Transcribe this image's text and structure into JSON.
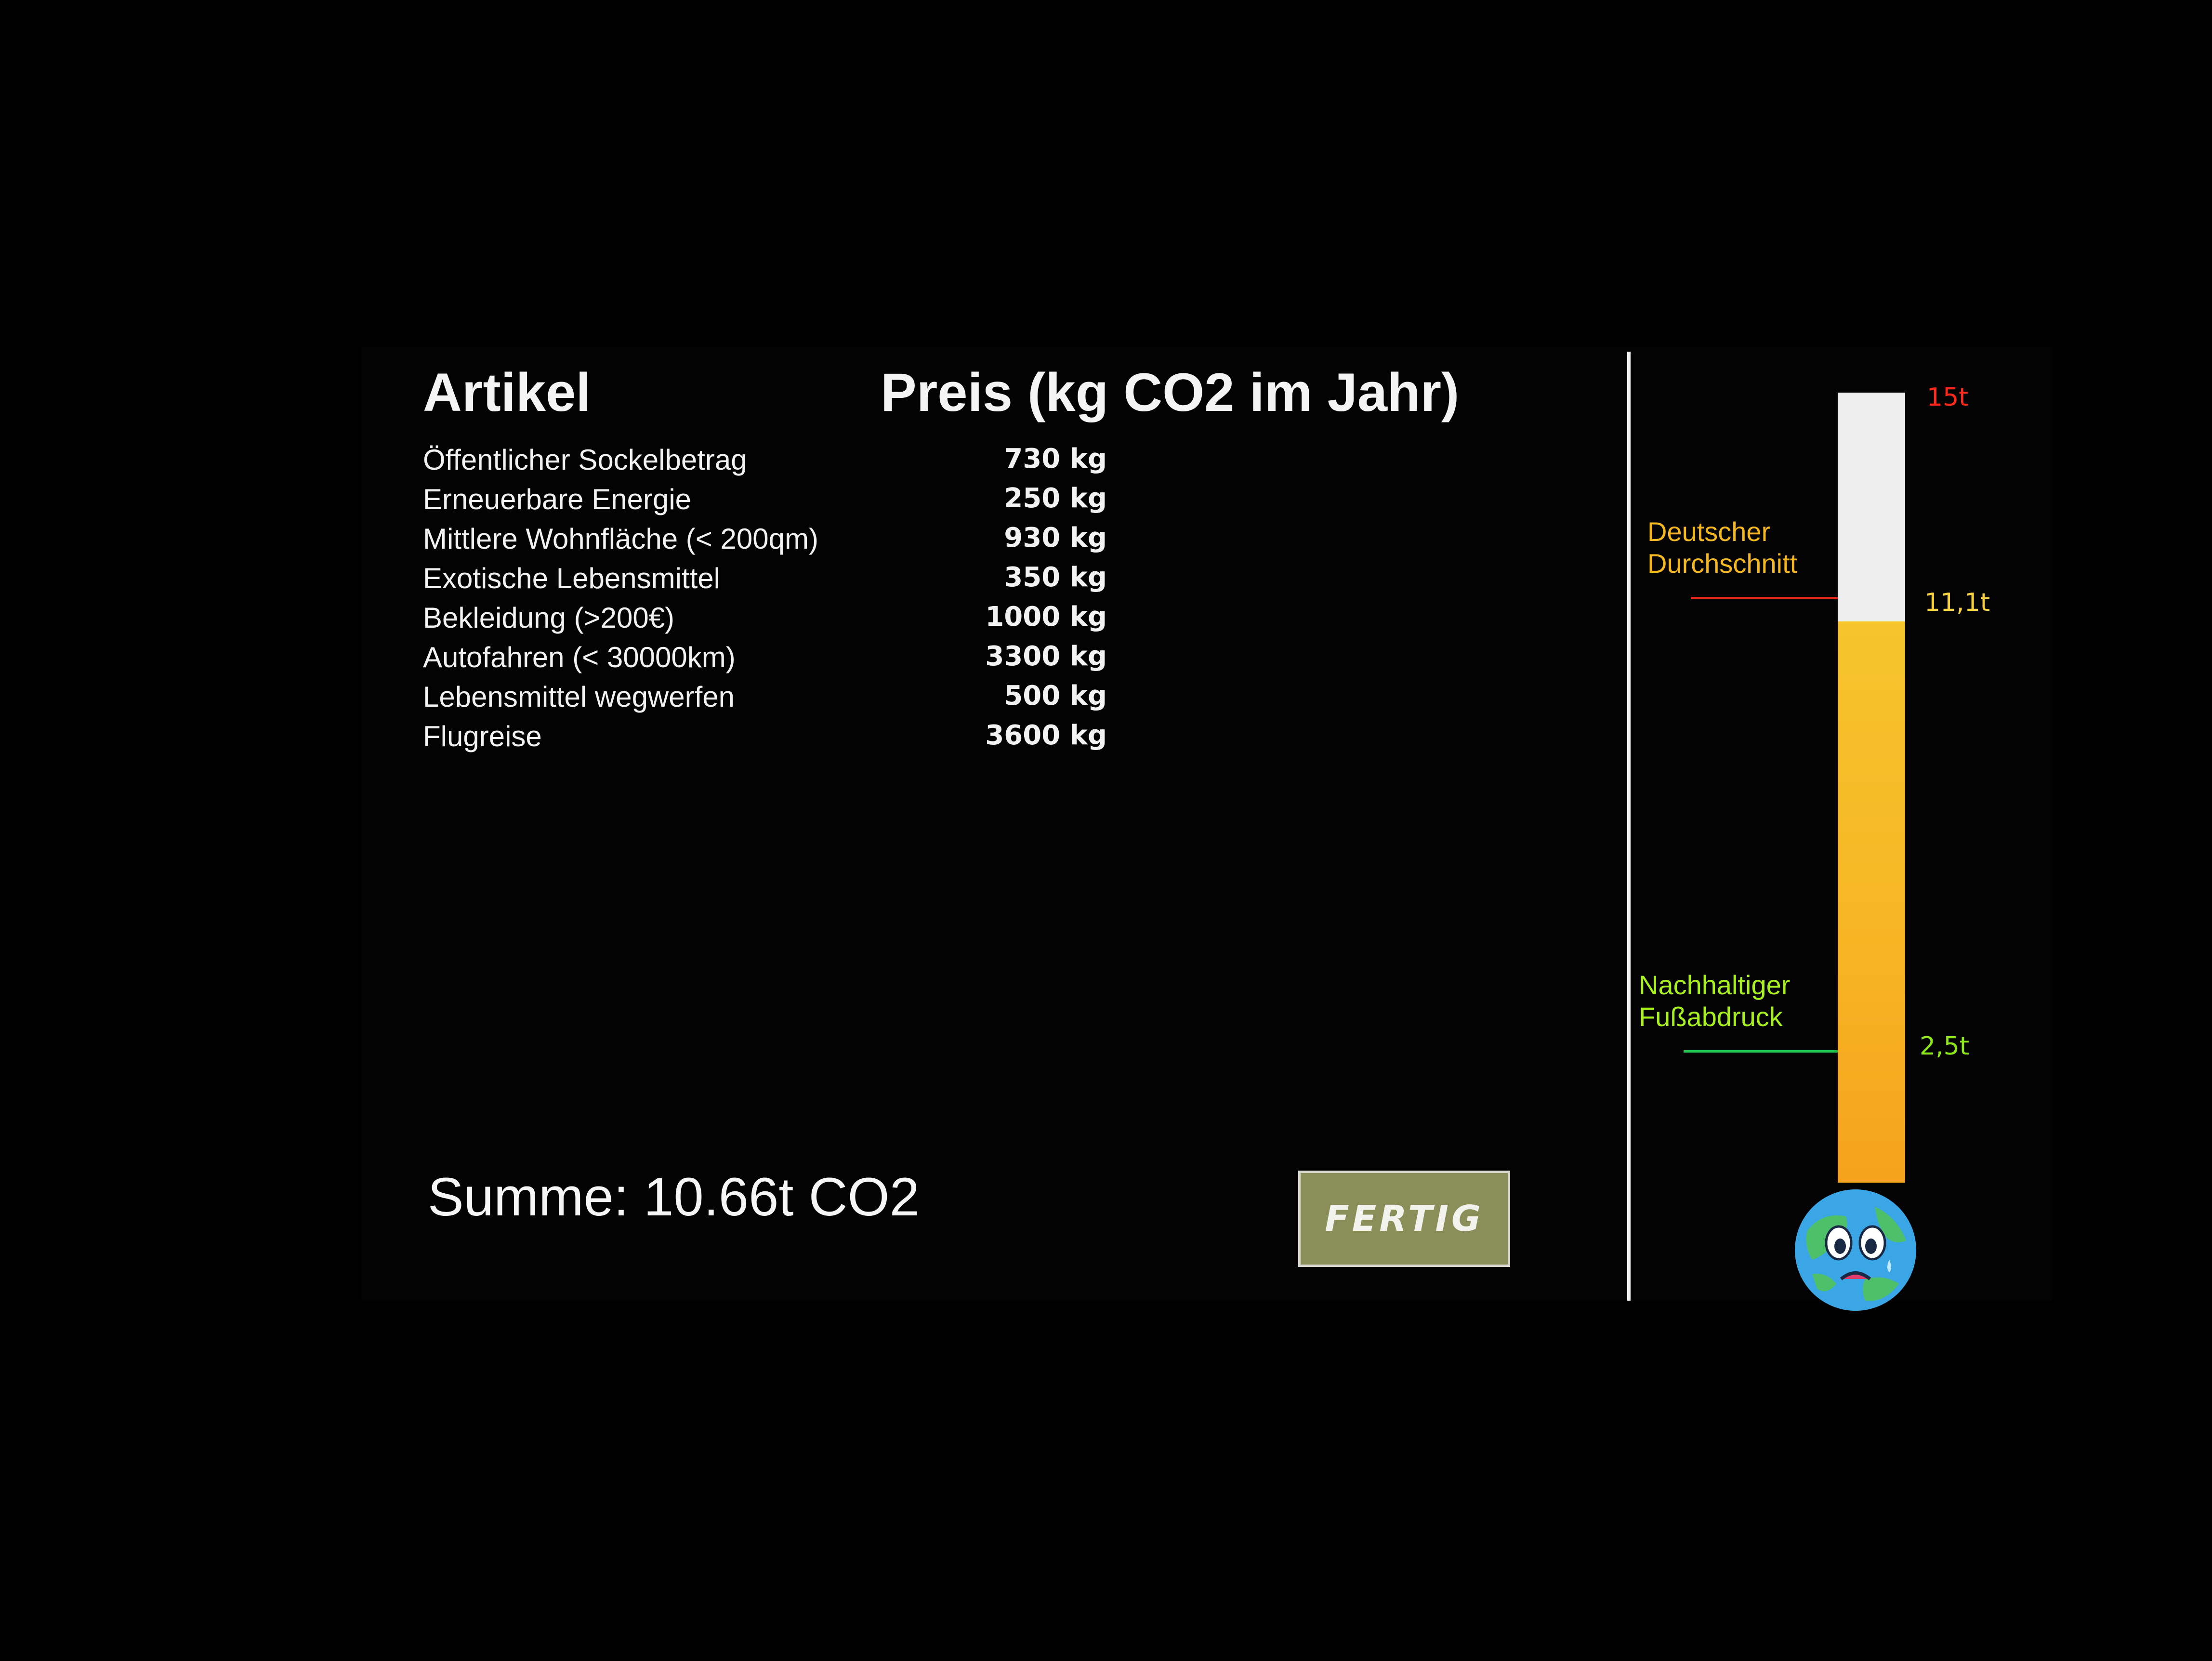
{
  "table": {
    "col_item": "Artikel",
    "col_price": "Preis (kg CO2 im Jahr)",
    "rows": [
      {
        "name": "Öffentlicher Sockelbetrag",
        "value": "730 kg"
      },
      {
        "name": "Erneuerbare Energie",
        "value": "250 kg"
      },
      {
        "name": "Mittlere Wohnfläche (< 200qm)",
        "value": "930 kg"
      },
      {
        "name": "Exotische Lebensmittel",
        "value": "350 kg"
      },
      {
        "name": "Bekleidung (>200€)",
        "value": "1000 kg"
      },
      {
        "name": "Autofahren (< 30000km)",
        "value": "3300 kg"
      },
      {
        "name": "Lebensmittel wegwerfen",
        "value": "500 kg"
      },
      {
        "name": "Flugreise",
        "value": "3600 kg"
      }
    ]
  },
  "summary": {
    "text": "Summe: 10.66t CO2",
    "total_t": 10.66
  },
  "button": {
    "label": "FERTIG"
  },
  "thermometer": {
    "max_label": "15t",
    "max_t": 15,
    "avg_label": "11,1t",
    "avg_t": 11.1,
    "avg_text": "Deutscher\nDurchschnitt",
    "sustainable_label": "2,5t",
    "sustainable_t": 2.5,
    "sustainable_text": "Nachhaltiger\nFußabdruck",
    "fill_t": 10.66
  },
  "colors": {
    "max": "#ff2a1a",
    "avg_text": "#f5b820",
    "avg_line": "#e8261e",
    "avg_value": "#f7d040",
    "sustainable_text": "#a8f020",
    "sustainable_line": "#22c24a",
    "sustainable_value": "#8ee81a"
  }
}
